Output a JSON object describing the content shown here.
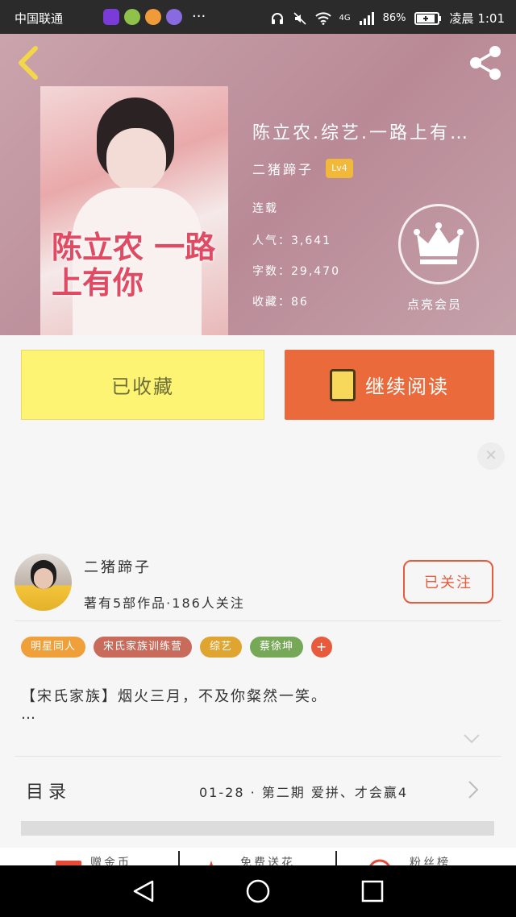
{
  "status_bar": {
    "carrier": "中国联通",
    "more": "···",
    "network": "4G",
    "battery": "86%",
    "time": "凌晨 1:01"
  },
  "book": {
    "title": "陈立农.综艺.一路上有…",
    "cover_title": "陈立农 一路上有你",
    "author": "二猪蹄子",
    "level": "Lv4",
    "status": "连载",
    "popularity": "人气：3,641",
    "word_count": "字数：29,470",
    "favorites": "收藏：86",
    "crown_label": "点亮会员"
  },
  "actions": {
    "collected": "已收藏",
    "continue_reading": "继续阅读"
  },
  "author_card": {
    "name": "二猪蹄子",
    "stats": "著有5部作品·186人关注",
    "follow_label": "已关注"
  },
  "tags": [
    {
      "label": "明星同人",
      "color": "#f0a03a"
    },
    {
      "label": "宋氏家族训练营",
      "color": "#c86b5a"
    },
    {
      "label": "综艺",
      "color": "#e0a530"
    },
    {
      "label": "蔡徐坤",
      "color": "#76a858"
    },
    {
      "label": "+",
      "color": "#e85a3c"
    }
  ],
  "intro": {
    "text": "【宋氏家族】烟火三月，不及你粲然一笑。",
    "more": "…"
  },
  "toc": {
    "label": "目录",
    "latest": "01-28 · 第二期 爱拼、才会赢4"
  },
  "bottom_bar": [
    "赠金币",
    "免费送花",
    "粉丝榜"
  ],
  "colors": {
    "accent": "#ea6a3b",
    "collected_bg": "#fef474"
  }
}
